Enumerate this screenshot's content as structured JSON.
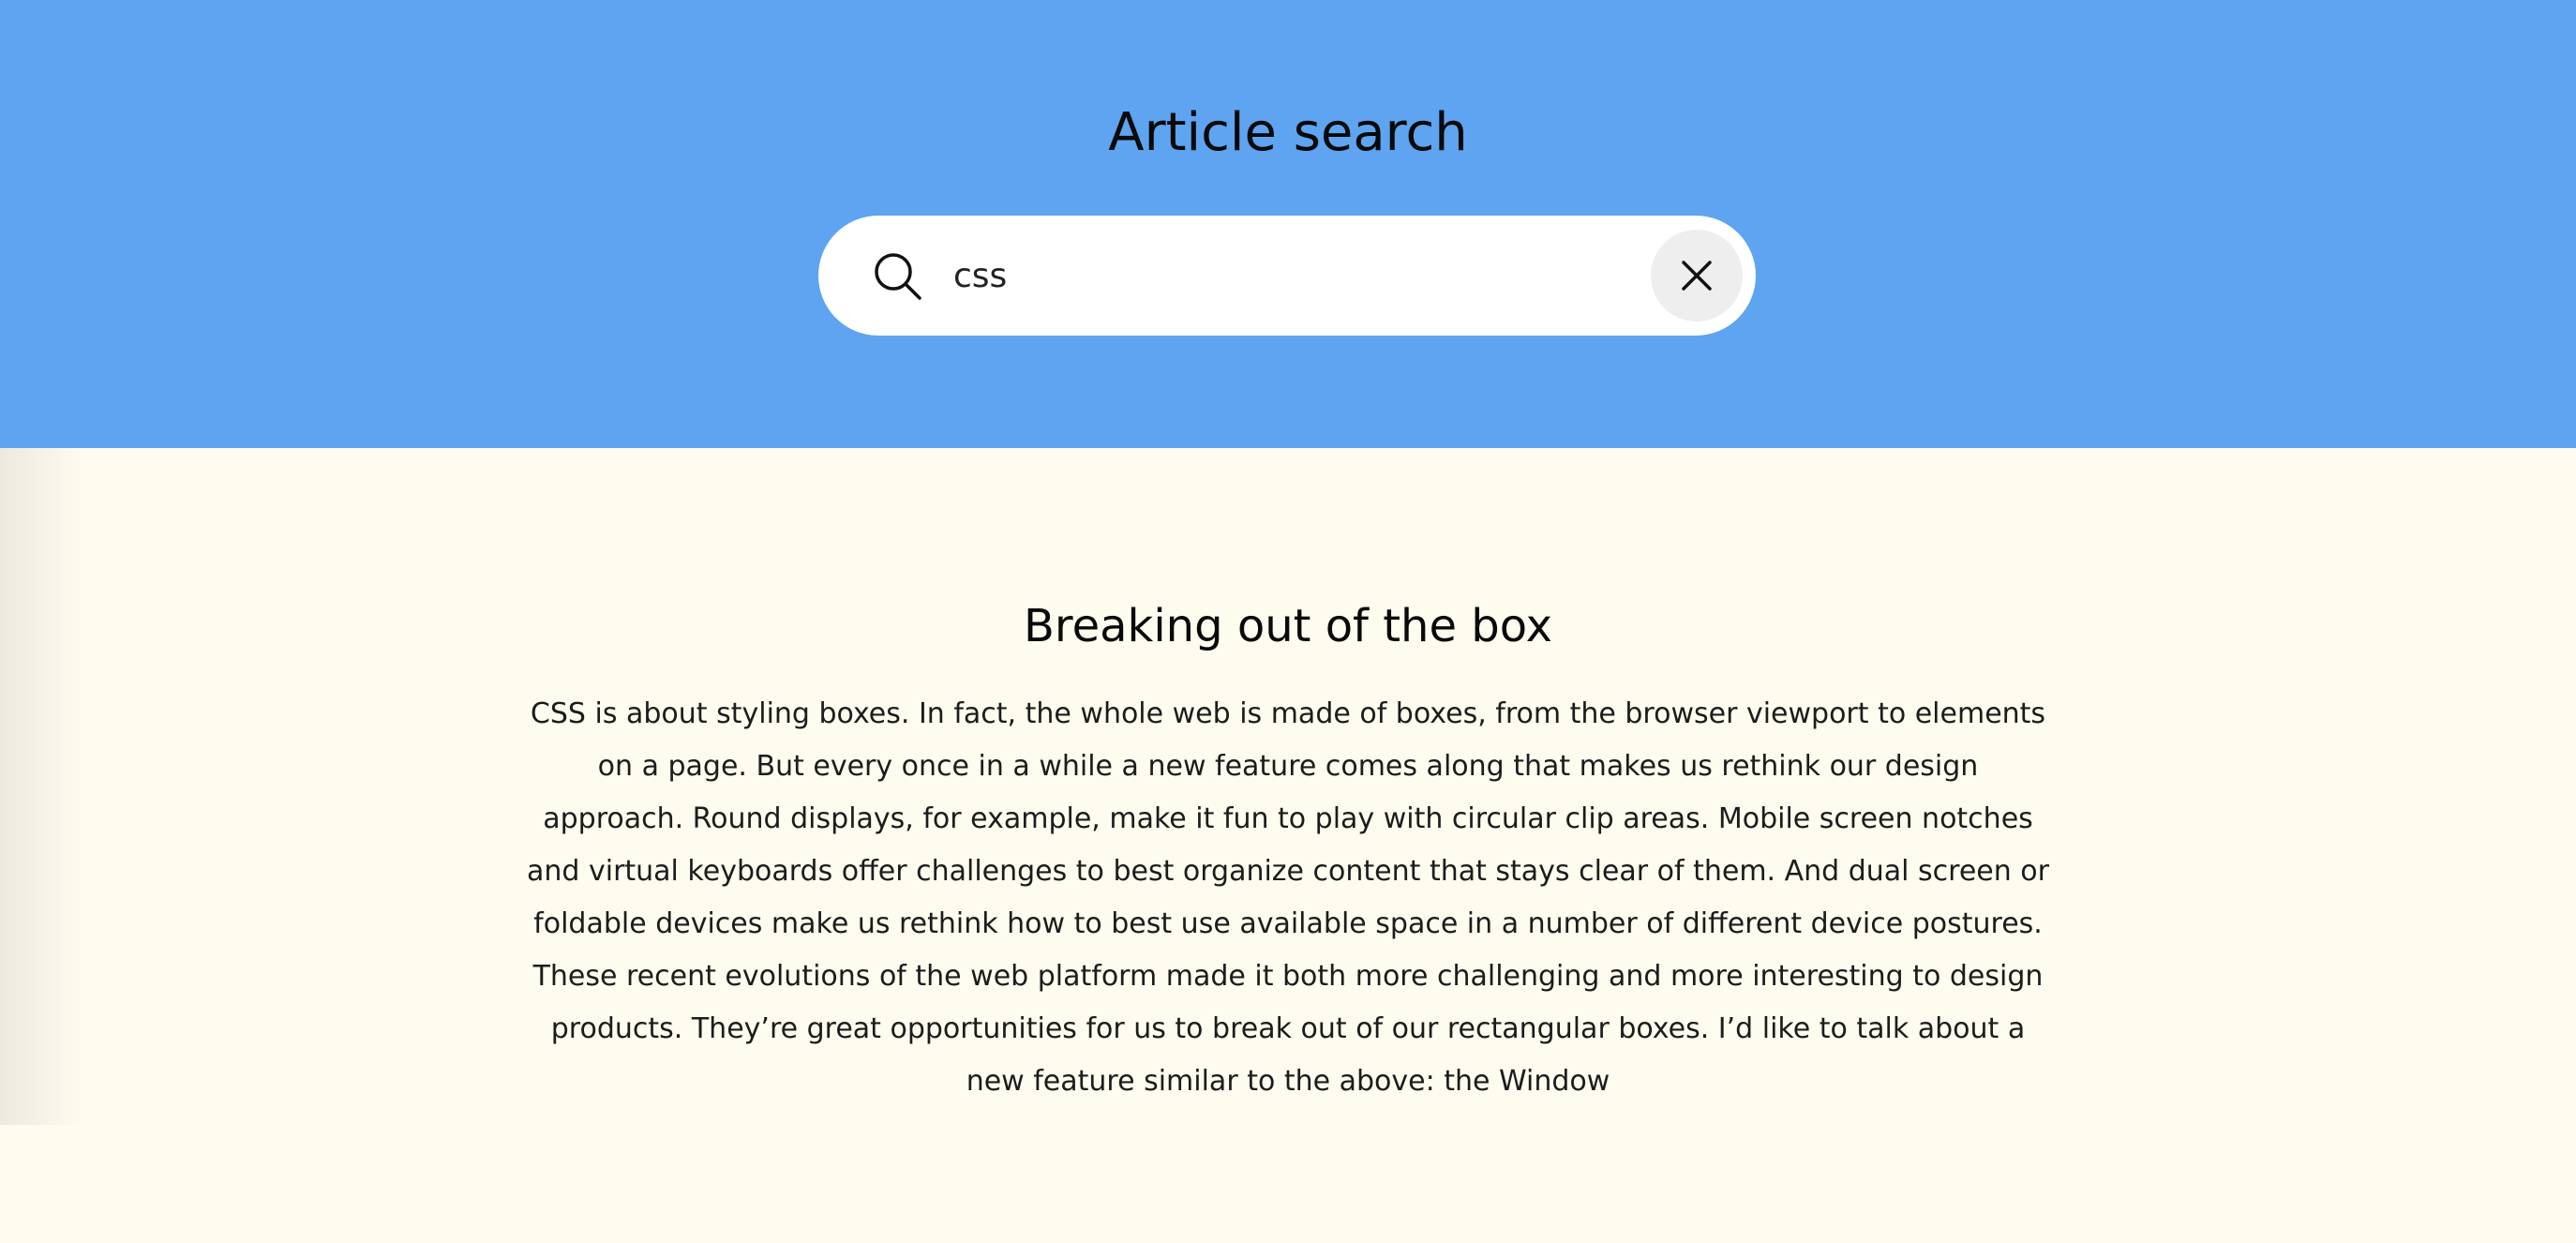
{
  "header": {
    "title": "Article search"
  },
  "search": {
    "value": "css",
    "placeholder": "",
    "search_icon": "search-icon",
    "clear_icon": "close-icon"
  },
  "article": {
    "title": "Breaking out of the box",
    "body": "CSS is about styling boxes. In fact, the whole web is made of boxes, from the browser viewport to elements on a page. But every once in a while a new feature comes along that makes us rethink our design approach. Round displays, for example, make it fun to play with circular clip areas. Mobile screen notches and virtual keyboards offer challenges to best organize content that stays clear of them. And dual screen or foldable devices make us rethink how to best use available space in a number of different device postures. These recent evolutions of the web platform made it both more challenging and more interesting to design products. They’re great opportunities for us to break out of our rectangular boxes. I’d like to talk about a new feature similar to the above: the Window"
  },
  "colors": {
    "header_bg": "#5ea4f0",
    "page_bg": "#fefbef",
    "search_bg": "#ffffff",
    "clear_button_bg": "#eeeeee"
  }
}
